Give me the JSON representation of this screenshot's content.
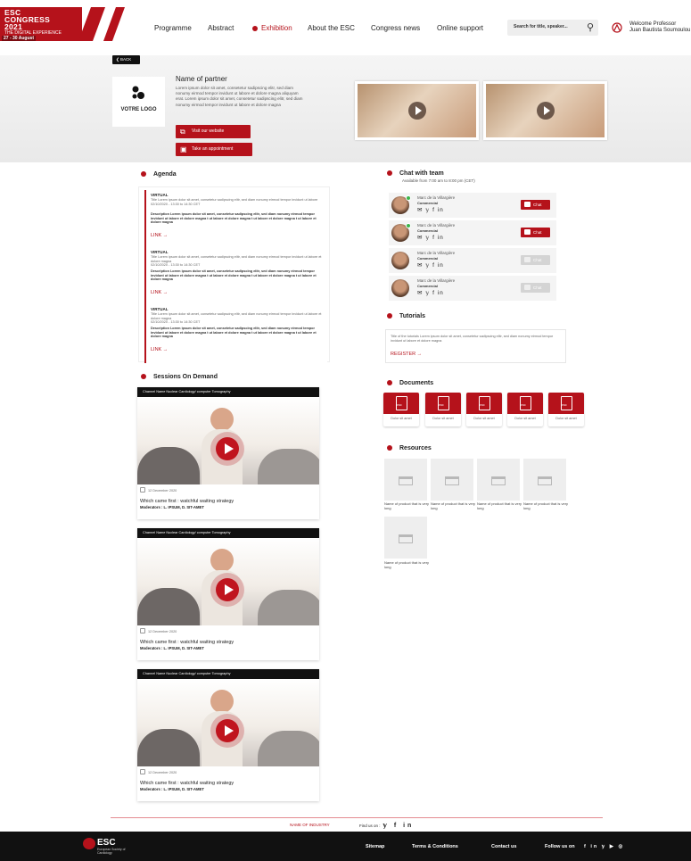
{
  "header": {
    "logo": {
      "line1": "ESC",
      "line2": "CONGRESS",
      "line3": "2021",
      "sub": "THE DIGITAL EXPERIENCE",
      "dates": "27 - 30 August"
    },
    "nav": [
      {
        "label": "Programme"
      },
      {
        "label": "Abstract"
      },
      {
        "label": "Exhibition",
        "active": true
      },
      {
        "label": "About the ESC"
      },
      {
        "label": "Congress news"
      },
      {
        "label": "Online support"
      }
    ],
    "search_placeholder": "Search for title, speaker...",
    "welcome_line1": "Welcome Professor",
    "welcome_line2": "Juan Bautista Soumoulou"
  },
  "hero": {
    "back_label": "BACK",
    "logo_text": "VOTRE LOGO",
    "partner_name": "Name of partner",
    "partner_desc": "Lorem ipsum dolor sit amet, consetetur sadipscing elitr, sed diam nonumy eirmod tempor invidunt ut labore et dolore magna aliquyam erat. Lorem ipsum dolor sit amet, consetetur sadipscing elitr, sed diam nonumy eirmod tempor invidunt ut labore et dolore magna",
    "visit_label": "Visit our website",
    "appointment_label": "Take an appointment"
  },
  "agenda": {
    "title": "Agenda",
    "items": [
      {
        "tag": "VIRTUAL",
        "title": "Title Lorem ipsum dolor sit amet, consetetur sadipscing elitr, sed diam nonumy eirmod tempor invidunt ut labore",
        "time": "02/10/2020 - 13:30 to 14:30 CET",
        "desc": "Description Lorem ipsum dolor sit amet, consetetur sadipscing elitr, sed diam nonumy eirmod tempor invidunt ut labore et dolore magna t ut labore et dolore magna t ut labore et dolore magna t ut labore et dolore magna",
        "link": "LINK"
      },
      {
        "tag": "VIRTUAL",
        "title": "Title Lorem ipsum dolor sit amet, consetetur sadipscing elitr, sed diam nonumy eirmod tempor invidunt ut labore et dolore magna",
        "time": "02/10/2020 - 13:30 to 14:30 CET",
        "desc": "Description Lorem ipsum dolor sit amet, consetetur sadipscing elitr, sed diam nonumy eirmod tempor invidunt ut labore et dolore magna t ut labore et dolore magna t ut labore et dolore magna t ut labore et dolore magna",
        "link": "LINK"
      },
      {
        "tag": "VIRTUAL",
        "title": "Title Lorem ipsum dolor sit amet, consetetur sadipscing elitr, sed diam nonumy eirmod tempor invidunt ut labore et dolore magna",
        "time": "02/10/2020 - 13:30 to 14:30 CET",
        "desc": "Description Lorem ipsum dolor sit amet, consetetur sadipscing elitr, sed diam nonumy eirmod tempor invidunt ut labore et dolore magna t ut labore et dolore magna t ut labore et dolore magna t ut labore et dolore magna",
        "link": "LINK"
      }
    ]
  },
  "sessions": {
    "title": "Sessions On Demand",
    "items": [
      {
        "channel": "Channel Name Nuclear Cardiology/ computer Tomography",
        "date": "12 December 2020",
        "title": "Which came first : watchful waiting strategy",
        "moderators": "Moderators : L. IPSUM, D. SIT-AMET"
      },
      {
        "channel": "Channel Name Nuclear Cardiology/ computer Tomography",
        "date": "12 December 2020",
        "title": "Which came first : watchful waiting strategy",
        "moderators": "Moderators : L. IPSUM, D. SIT-AMET"
      },
      {
        "channel": "Channel Name Nuclear Cardiology/ computer Tomography",
        "date": "12 December 2020",
        "title": "Which came first : watchful waiting strategy",
        "moderators": "Moderators : L. IPSUM, D. SIT-AMET"
      }
    ]
  },
  "chat": {
    "title": "Chat with team",
    "subtitle": "Available from 7:00 am to 8:00 pm (CET)",
    "members": [
      {
        "name": "Marc de la Villargière",
        "role": "Commercial",
        "button": "Chat",
        "online": true
      },
      {
        "name": "Marc de la Villargière",
        "role": "Commercial",
        "button": "Chat",
        "online": true
      },
      {
        "name": "Marc de la Villargière",
        "role": "Commercial",
        "button": "Chat",
        "online": false
      },
      {
        "name": "Marc de la Villargière",
        "role": "Commercial",
        "button": "Chat",
        "online": false
      }
    ]
  },
  "tutorials": {
    "title": "Tutorials",
    "text": "Title of the tutorials Lorem ipsum dolor sit amet, consetetur sadipscing elitr, sed diam nonumy eirmod tempor invidunt ut labore et dolore magna",
    "register": "REGISTER"
  },
  "documents": {
    "title": "Documents",
    "items": [
      "Dolor sit amet",
      "Dolor sit amet",
      "Dolor sit amet",
      "Dolor sit amet",
      "Dolor sit amet"
    ]
  },
  "resources": {
    "title": "Resources",
    "items": [
      "Name of product that is very long",
      "Name of product that is very long",
      "Name of product that is very long",
      "Name of product that is very long",
      "Name of product that is very long"
    ]
  },
  "footer": {
    "industry": "NAME OF INDUSTRY",
    "find_us": "Find us on :",
    "logo": "ESC",
    "logo_sub": "European Society of Cardiology",
    "links": [
      "Sitemap",
      "Terms & Conditions",
      "Contact us"
    ],
    "follow": "Follow us on"
  },
  "colors": {
    "brand": "#b5121b",
    "footer": "#111111",
    "online": "#3bb54a"
  }
}
